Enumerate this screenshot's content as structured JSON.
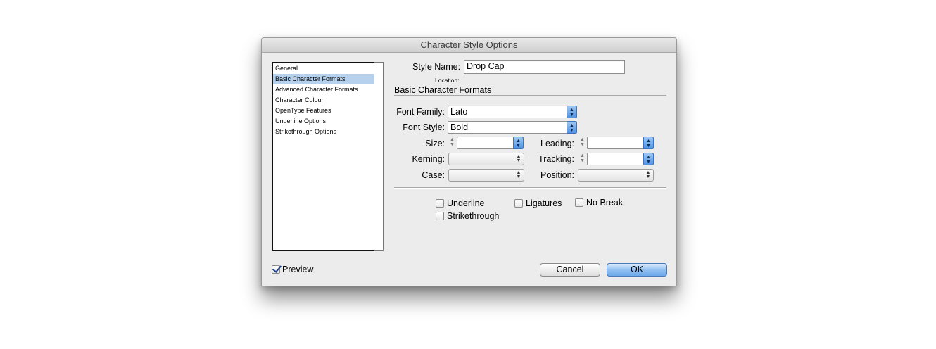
{
  "window": {
    "title": "Character Style Options"
  },
  "sidebar": {
    "items": [
      {
        "label": "General",
        "selected": false
      },
      {
        "label": "Basic Character Formats",
        "selected": true
      },
      {
        "label": "Advanced Character Formats",
        "selected": false
      },
      {
        "label": "Character Colour",
        "selected": false
      },
      {
        "label": "OpenType Features",
        "selected": false
      },
      {
        "label": "Underline Options",
        "selected": false
      },
      {
        "label": "Strikethrough Options",
        "selected": false
      }
    ]
  },
  "form": {
    "style_name_label": "Style Name:",
    "style_name_value": "Drop Cap",
    "location_label": "Location:",
    "section_title": "Basic Character Formats",
    "font_family_label": "Font Family:",
    "font_family_value": "Lato",
    "font_style_label": "Font Style:",
    "font_style_value": "Bold",
    "size_label": "Size:",
    "size_value": "",
    "leading_label": "Leading:",
    "leading_value": "",
    "kerning_label": "Kerning:",
    "kerning_value": "",
    "tracking_label": "Tracking:",
    "tracking_value": "",
    "case_label": "Case:",
    "case_value": "",
    "position_label": "Position:",
    "position_value": ""
  },
  "options": {
    "underline_label": "Underline",
    "underline_checked": false,
    "ligatures_label": "Ligatures",
    "ligatures_checked": false,
    "nobreak_label": "No Break",
    "nobreak_checked": false,
    "strikethrough_label": "Strikethrough",
    "strikethrough_checked": false
  },
  "footer": {
    "preview_label": "Preview",
    "preview_checked": true,
    "cancel_label": "Cancel",
    "ok_label": "OK"
  },
  "colors": {
    "selection": "#b5d1ee",
    "accent": "#6ea9ea"
  },
  "icons": {
    "stepper": "up-down-arrows-icon",
    "popup": "up-down-chevron-icon",
    "check": "checkmark-icon"
  }
}
